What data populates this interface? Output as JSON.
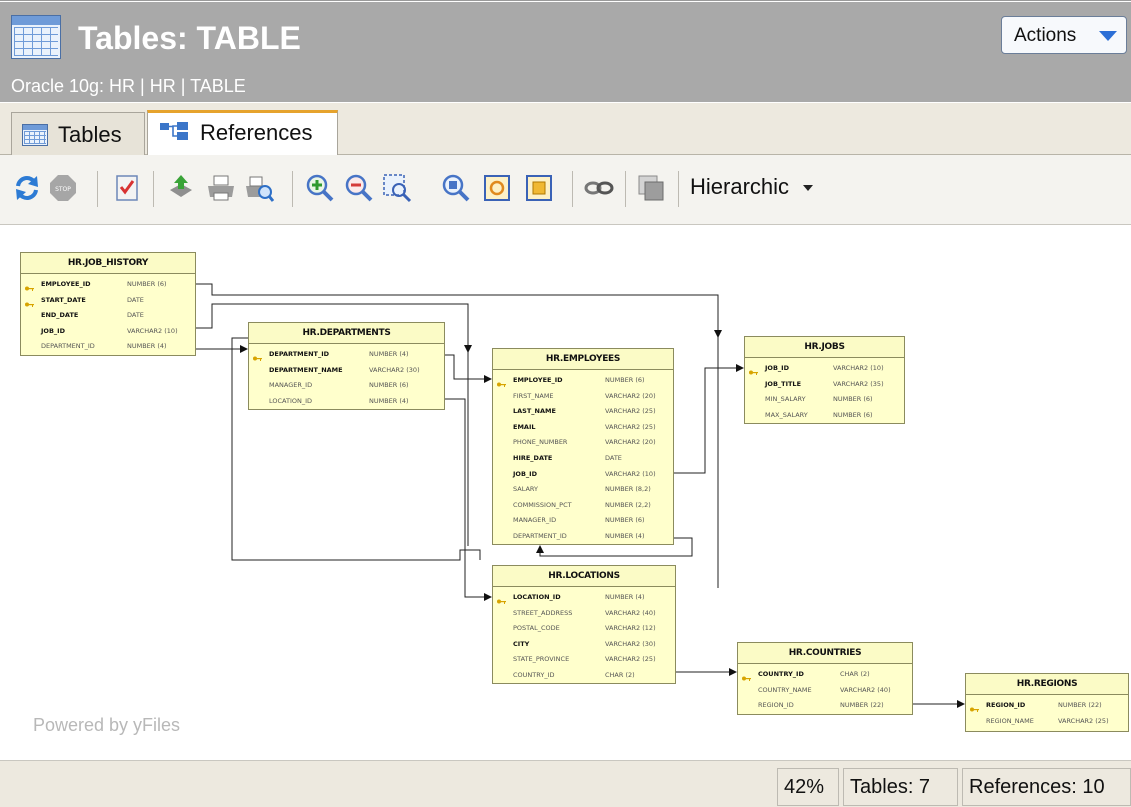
{
  "window": {
    "title": "Tables: TABLE",
    "subtitle": "Oracle 10g: HR | HR | TABLE",
    "actions_label": "Actions"
  },
  "tabs": [
    {
      "label": "Tables",
      "icon": "table-icon",
      "selected": false
    },
    {
      "label": "References",
      "icon": "references-diagram-icon",
      "selected": true
    }
  ],
  "toolbar": {
    "buttons": [
      "refresh-icon",
      "stop-icon",
      "checklist-icon",
      "export-icon",
      "print-icon",
      "print-preview-icon",
      "zoom-in-icon",
      "zoom-out-icon",
      "zoom-region-icon",
      "zoom-fit-icon",
      "fit-content-icon",
      "fit-page-icon",
      "link-icon",
      "layers-icon"
    ],
    "layout_label": "Hierarchic"
  },
  "diagram": {
    "watermark": "Powered by yFiles",
    "entities": [
      {
        "id": "job_history",
        "name": "HR.JOB_HISTORY",
        "columns": [
          {
            "name": "EMPLOYEE_ID",
            "type": "NUMBER (6)",
            "key": true,
            "bold": true
          },
          {
            "name": "START_DATE",
            "type": "DATE",
            "key": true,
            "bold": true
          },
          {
            "name": "END_DATE",
            "type": "DATE",
            "key": false,
            "bold": true
          },
          {
            "name": "JOB_ID",
            "type": "VARCHAR2 (10)",
            "key": false,
            "bold": true
          },
          {
            "name": "DEPARTMENT_ID",
            "type": "NUMBER (4)",
            "key": false,
            "bold": false
          }
        ]
      },
      {
        "id": "departments",
        "name": "HR.DEPARTMENTS",
        "columns": [
          {
            "name": "DEPARTMENT_ID",
            "type": "NUMBER (4)",
            "key": true,
            "bold": true
          },
          {
            "name": "DEPARTMENT_NAME",
            "type": "VARCHAR2 (30)",
            "key": false,
            "bold": true
          },
          {
            "name": "MANAGER_ID",
            "type": "NUMBER (6)",
            "key": false,
            "bold": false
          },
          {
            "name": "LOCATION_ID",
            "type": "NUMBER (4)",
            "key": false,
            "bold": false
          }
        ]
      },
      {
        "id": "employees",
        "name": "HR.EMPLOYEES",
        "columns": [
          {
            "name": "EMPLOYEE_ID",
            "type": "NUMBER (6)",
            "key": true,
            "bold": true
          },
          {
            "name": "FIRST_NAME",
            "type": "VARCHAR2 (20)",
            "key": false,
            "bold": false
          },
          {
            "name": "LAST_NAME",
            "type": "VARCHAR2 (25)",
            "key": false,
            "bold": true
          },
          {
            "name": "EMAIL",
            "type": "VARCHAR2 (25)",
            "key": false,
            "bold": true
          },
          {
            "name": "PHONE_NUMBER",
            "type": "VARCHAR2 (20)",
            "key": false,
            "bold": false
          },
          {
            "name": "HIRE_DATE",
            "type": "DATE",
            "key": false,
            "bold": true
          },
          {
            "name": "JOB_ID",
            "type": "VARCHAR2 (10)",
            "key": false,
            "bold": true
          },
          {
            "name": "SALARY",
            "type": "NUMBER (8,2)",
            "key": false,
            "bold": false
          },
          {
            "name": "COMMISSION_PCT",
            "type": "NUMBER (2,2)",
            "key": false,
            "bold": false
          },
          {
            "name": "MANAGER_ID",
            "type": "NUMBER (6)",
            "key": false,
            "bold": false
          },
          {
            "name": "DEPARTMENT_ID",
            "type": "NUMBER (4)",
            "key": false,
            "bold": false
          }
        ]
      },
      {
        "id": "jobs",
        "name": "HR.JOBS",
        "columns": [
          {
            "name": "JOB_ID",
            "type": "VARCHAR2 (10)",
            "key": true,
            "bold": true
          },
          {
            "name": "JOB_TITLE",
            "type": "VARCHAR2 (35)",
            "key": false,
            "bold": true
          },
          {
            "name": "MIN_SALARY",
            "type": "NUMBER (6)",
            "key": false,
            "bold": false
          },
          {
            "name": "MAX_SALARY",
            "type": "NUMBER (6)",
            "key": false,
            "bold": false
          }
        ]
      },
      {
        "id": "locations",
        "name": "HR.LOCATIONS",
        "columns": [
          {
            "name": "LOCATION_ID",
            "type": "NUMBER (4)",
            "key": true,
            "bold": true
          },
          {
            "name": "STREET_ADDRESS",
            "type": "VARCHAR2 (40)",
            "key": false,
            "bold": false
          },
          {
            "name": "POSTAL_CODE",
            "type": "VARCHAR2 (12)",
            "key": false,
            "bold": false
          },
          {
            "name": "CITY",
            "type": "VARCHAR2 (30)",
            "key": false,
            "bold": true
          },
          {
            "name": "STATE_PROVINCE",
            "type": "VARCHAR2 (25)",
            "key": false,
            "bold": false
          },
          {
            "name": "COUNTRY_ID",
            "type": "CHAR (2)",
            "key": false,
            "bold": false
          }
        ]
      },
      {
        "id": "countries",
        "name": "HR.COUNTRIES",
        "columns": [
          {
            "name": "COUNTRY_ID",
            "type": "CHAR (2)",
            "key": true,
            "bold": true
          },
          {
            "name": "COUNTRY_NAME",
            "type": "VARCHAR2 (40)",
            "key": false,
            "bold": false
          },
          {
            "name": "REGION_ID",
            "type": "NUMBER (22)",
            "key": false,
            "bold": false
          }
        ]
      },
      {
        "id": "regions",
        "name": "HR.REGIONS",
        "columns": [
          {
            "name": "REGION_ID",
            "type": "NUMBER (22)",
            "key": true,
            "bold": true
          },
          {
            "name": "REGION_NAME",
            "type": "VARCHAR2 (25)",
            "key": false,
            "bold": false
          }
        ]
      }
    ]
  },
  "status": {
    "zoom": "42%",
    "tables": "Tables: 7",
    "references": "References: 10"
  }
}
